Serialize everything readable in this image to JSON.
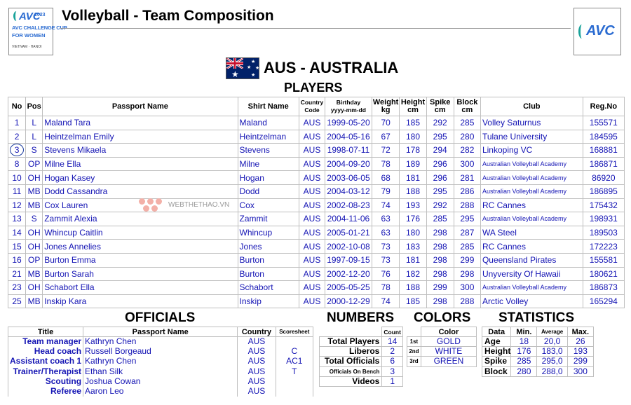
{
  "header": {
    "title": "Volleyball - Team Composition",
    "event_logo": {
      "brand": "AVC",
      "year": "2023",
      "line1": "AVC CHALLENGE CUP",
      "line2": "FOR WOMEN",
      "line3": "VIETNAM · HANOI"
    },
    "federation_logo": "AVC"
  },
  "team": {
    "title": "AUS - AUSTRALIA",
    "flag_icon": "australia-flag-icon"
  },
  "players": {
    "heading": "PLAYERS",
    "columns": {
      "no": "No",
      "pos": "Pos",
      "name": "Passport Name",
      "shirt": "Shirt Name",
      "country_1": "Country",
      "country_2": "Code",
      "birth_1": "Birthday",
      "birth_2": "yyyy-mm-dd",
      "weight_1": "Weight",
      "weight_2": "kg",
      "height_1": "Height",
      "height_2": "cm",
      "spike_1": "Spike",
      "spike_2": "cm",
      "block_1": "Block",
      "block_2": "cm",
      "club": "Club",
      "reg": "Reg.No"
    },
    "rows": [
      {
        "no": "1",
        "pos": "L",
        "name": "Maland Tara",
        "shirt": "Maland",
        "country": "AUS",
        "birthday": "1999-05-20",
        "weight": "70",
        "height": "185",
        "spike": "292",
        "block": "285",
        "club": "Volley Saturnus",
        "reg": "155571"
      },
      {
        "no": "2",
        "pos": "L",
        "name": "Heintzelman Emily",
        "shirt": "Heintzelman",
        "country": "AUS",
        "birthday": "2004-05-16",
        "weight": "67",
        "height": "180",
        "spike": "295",
        "block": "280",
        "club": "Tulane University",
        "reg": "184595"
      },
      {
        "no": "3",
        "pos": "S",
        "name": "Stevens Mikaela",
        "shirt": "Stevens",
        "country": "AUS",
        "birthday": "1998-07-11",
        "weight": "72",
        "height": "178",
        "spike": "294",
        "block": "282",
        "club": "Linkoping VC",
        "reg": "168881",
        "captain": true
      },
      {
        "no": "8",
        "pos": "OP",
        "name": "Milne Ella",
        "shirt": "Milne",
        "country": "AUS",
        "birthday": "2004-09-20",
        "weight": "78",
        "height": "189",
        "spike": "296",
        "block": "300",
        "club": "Australian Volleyball Academy",
        "reg": "186871"
      },
      {
        "no": "10",
        "pos": "OH",
        "name": "Hogan Kasey",
        "shirt": "Hogan",
        "country": "AUS",
        "birthday": "2003-06-05",
        "weight": "68",
        "height": "181",
        "spike": "296",
        "block": "281",
        "club": "Australian Volleyball Academy",
        "reg": "86920"
      },
      {
        "no": "11",
        "pos": "MB",
        "name": "Dodd Cassandra",
        "shirt": "Dodd",
        "country": "AUS",
        "birthday": "2004-03-12",
        "weight": "79",
        "height": "188",
        "spike": "295",
        "block": "286",
        "club": "Australian Volleyball Academy",
        "reg": "186895"
      },
      {
        "no": "12",
        "pos": "MB",
        "name": "Cox Lauren",
        "shirt": "Cox",
        "country": "AUS",
        "birthday": "2002-08-23",
        "weight": "74",
        "height": "193",
        "spike": "292",
        "block": "288",
        "club": "RC Cannes",
        "reg": "175432"
      },
      {
        "no": "13",
        "pos": "S",
        "name": "Zammit Alexia",
        "shirt": "Zammit",
        "country": "AUS",
        "birthday": "2004-11-06",
        "weight": "63",
        "height": "176",
        "spike": "285",
        "block": "295",
        "club": "Australian Volleyball Academy",
        "reg": "198931"
      },
      {
        "no": "14",
        "pos": "OH",
        "name": "Whincup Caitlin",
        "shirt": "Whincup",
        "country": "AUS",
        "birthday": "2005-01-21",
        "weight": "63",
        "height": "180",
        "spike": "298",
        "block": "287",
        "club": "WA Steel",
        "reg": "189503"
      },
      {
        "no": "15",
        "pos": "OH",
        "name": "Jones Annelies",
        "shirt": "Jones",
        "country": "AUS",
        "birthday": "2002-10-08",
        "weight": "73",
        "height": "183",
        "spike": "298",
        "block": "285",
        "club": "RC Cannes",
        "reg": "172223"
      },
      {
        "no": "16",
        "pos": "OP",
        "name": "Burton Emma",
        "shirt": "Burton",
        "country": "AUS",
        "birthday": "1997-09-15",
        "weight": "73",
        "height": "181",
        "spike": "298",
        "block": "299",
        "club": "Queensland Pirates",
        "reg": "155581"
      },
      {
        "no": "21",
        "pos": "MB",
        "name": "Burton Sarah",
        "shirt": "Burton",
        "country": "AUS",
        "birthday": "2002-12-20",
        "weight": "76",
        "height": "182",
        "spike": "298",
        "block": "298",
        "club": "Unyversity Of Hawaii",
        "reg": "180621"
      },
      {
        "no": "23",
        "pos": "OH",
        "name": "Schabort Ella",
        "shirt": "Schabort",
        "country": "AUS",
        "birthday": "2005-05-25",
        "weight": "78",
        "height": "188",
        "spike": "299",
        "block": "300",
        "club": "Australian Volleyball Academy",
        "reg": "186873"
      },
      {
        "no": "25",
        "pos": "MB",
        "name": "Inskip Kara",
        "shirt": "Inskip",
        "country": "AUS",
        "birthday": "2000-12-29",
        "weight": "74",
        "height": "185",
        "spike": "298",
        "block": "288",
        "club": "Arctic Volley",
        "reg": "165294"
      }
    ]
  },
  "watermark": "WEBTHETHAO.VN",
  "officials": {
    "heading": "OFFICIALS",
    "columns": {
      "title": "Title",
      "name": "Passport Name",
      "country": "Country",
      "scoresheet": "Scoresheet"
    },
    "rows": [
      {
        "title": "Team manager",
        "name": "Kathryn Chen",
        "country": "AUS",
        "scoresheet": ""
      },
      {
        "title": "Head coach",
        "name": "Russell Borgeaud",
        "country": "AUS",
        "scoresheet": "C"
      },
      {
        "title": "Assistant coach 1",
        "name": "Kathryn Chen",
        "country": "AUS",
        "scoresheet": "AC1"
      },
      {
        "title": "Trainer/Therapist",
        "name": "Ethan Silk",
        "country": "AUS",
        "scoresheet": "T"
      },
      {
        "title": "Scouting",
        "name": "Joshua Cowan",
        "country": "AUS",
        "scoresheet": ""
      },
      {
        "title": "Referee",
        "name": "Aaron Leo",
        "country": "AUS",
        "scoresheet": ""
      }
    ]
  },
  "numbers": {
    "heading": "NUMBERS",
    "column": "Count",
    "rows": [
      {
        "label": "Total Players",
        "value": "14"
      },
      {
        "label": "Liberos",
        "value": "2"
      },
      {
        "label": "Total Officials",
        "value": "6"
      },
      {
        "label": "Officials On Bench",
        "value": "3",
        "small": true
      },
      {
        "label": "Videos",
        "value": "1"
      }
    ]
  },
  "colors": {
    "heading": "COLORS",
    "column": "Color",
    "rows": [
      {
        "order": "1st",
        "value": "GOLD"
      },
      {
        "order": "2nd",
        "value": "WHITE"
      },
      {
        "order": "3rd",
        "value": "GREEN"
      }
    ]
  },
  "statistics": {
    "heading": "STATISTICS",
    "columns": {
      "data": "Data",
      "min": "Min.",
      "avg": "Average",
      "max": "Max."
    },
    "rows": [
      {
        "label": "Age",
        "min": "18",
        "avg": "20,0",
        "max": "26"
      },
      {
        "label": "Height",
        "min": "176",
        "avg": "183,0",
        "max": "193"
      },
      {
        "label": "Spike",
        "min": "285",
        "avg": "295,0",
        "max": "299"
      },
      {
        "label": "Block",
        "min": "280",
        "avg": "288,0",
        "max": "300"
      }
    ]
  },
  "colors_palette": {
    "text_value": "#1414b4",
    "avc_blue": "#2a6bd1",
    "avc_teal": "#1aa39a",
    "flag_blue": "#012169"
  }
}
